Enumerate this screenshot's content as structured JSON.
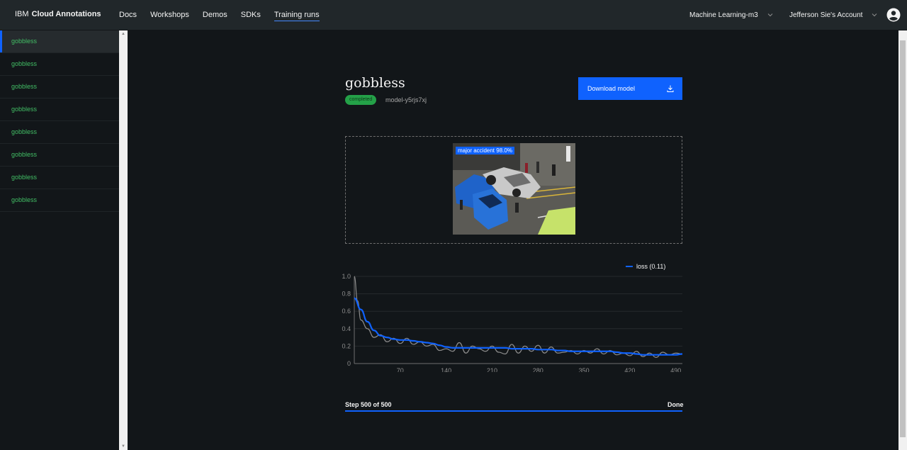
{
  "header": {
    "brand_prefix": "IBM",
    "brand_name": "Cloud Annotations",
    "nav": [
      {
        "label": "Docs"
      },
      {
        "label": "Workshops"
      },
      {
        "label": "Demos"
      },
      {
        "label": "SDKs"
      },
      {
        "label": "Training runs"
      }
    ],
    "active_nav": "Training runs",
    "region": "Machine Learning-m3",
    "account": "Jefferson Sie's Account"
  },
  "sidebar": {
    "items": [
      {
        "label": "gobbless"
      },
      {
        "label": "gobbless"
      },
      {
        "label": "gobbless"
      },
      {
        "label": "gobbless"
      },
      {
        "label": "gobbless"
      },
      {
        "label": "gobbless"
      },
      {
        "label": "gobbless"
      },
      {
        "label": "gobbless"
      }
    ],
    "selected_index": 0
  },
  "run": {
    "name": "gobbless",
    "status": "completed",
    "model_id": "model-y5rjs7xj",
    "download_label": "Download model",
    "detection_label": "major accident 98.0%"
  },
  "chart_data": {
    "type": "line",
    "legend": "loss (0.11)",
    "legend_position": "top-right",
    "xlim": [
      0,
      500
    ],
    "ylim": [
      0,
      1.0
    ],
    "x_ticks": [
      70,
      140,
      210,
      280,
      350,
      420,
      490
    ],
    "y_ticks": [
      "0",
      "0.2",
      "0.4",
      "0.6",
      "0.8",
      "1.0"
    ],
    "grid": true,
    "series": [
      {
        "name": "loss",
        "style": "smoothed",
        "color": "#0f62fe",
        "x": [
          0,
          10,
          20,
          30,
          40,
          50,
          60,
          70,
          80,
          90,
          100,
          110,
          120,
          130,
          140,
          150,
          160,
          170,
          180,
          190,
          200,
          210,
          220,
          230,
          240,
          250,
          260,
          270,
          280,
          290,
          300,
          310,
          320,
          330,
          340,
          350,
          360,
          370,
          380,
          390,
          400,
          410,
          420,
          430,
          440,
          450,
          460,
          470,
          480,
          490,
          500
        ],
        "y": [
          0.75,
          0.62,
          0.48,
          0.38,
          0.32,
          0.3,
          0.28,
          0.27,
          0.27,
          0.26,
          0.25,
          0.24,
          0.23,
          0.21,
          0.19,
          0.18,
          0.18,
          0.18,
          0.18,
          0.18,
          0.18,
          0.18,
          0.18,
          0.18,
          0.17,
          0.17,
          0.17,
          0.17,
          0.16,
          0.16,
          0.16,
          0.15,
          0.15,
          0.14,
          0.14,
          0.14,
          0.14,
          0.14,
          0.14,
          0.14,
          0.13,
          0.12,
          0.12,
          0.11,
          0.1,
          0.1,
          0.1,
          0.1,
          0.1,
          0.1,
          0.11
        ]
      },
      {
        "name": "raw",
        "style": "raw",
        "color": "#8d8d8d",
        "x": [
          0,
          5,
          10,
          20,
          30,
          40,
          50,
          60,
          70,
          80,
          90,
          100,
          110,
          120,
          130,
          140,
          150,
          160,
          170,
          180,
          190,
          200,
          210,
          220,
          230,
          240,
          250,
          260,
          270,
          280,
          290,
          300,
          310,
          320,
          330,
          340,
          350,
          360,
          370,
          380,
          390,
          400,
          410,
          420,
          430,
          440,
          450,
          460,
          470,
          480,
          490,
          500
        ],
        "y": [
          1.0,
          0.72,
          0.5,
          0.4,
          0.3,
          0.33,
          0.25,
          0.29,
          0.23,
          0.29,
          0.22,
          0.25,
          0.2,
          0.22,
          0.15,
          0.17,
          0.14,
          0.24,
          0.12,
          0.2,
          0.17,
          0.14,
          0.2,
          0.13,
          0.11,
          0.22,
          0.12,
          0.2,
          0.14,
          0.21,
          0.12,
          0.19,
          0.12,
          0.13,
          0.15,
          0.11,
          0.15,
          0.12,
          0.17,
          0.11,
          0.15,
          0.1,
          0.12,
          0.09,
          0.14,
          0.08,
          0.12,
          0.07,
          0.13,
          0.1,
          0.12,
          0.11
        ]
      }
    ]
  },
  "progress": {
    "label": "Step 500 of 500",
    "status": "Done",
    "fraction": 1.0
  }
}
